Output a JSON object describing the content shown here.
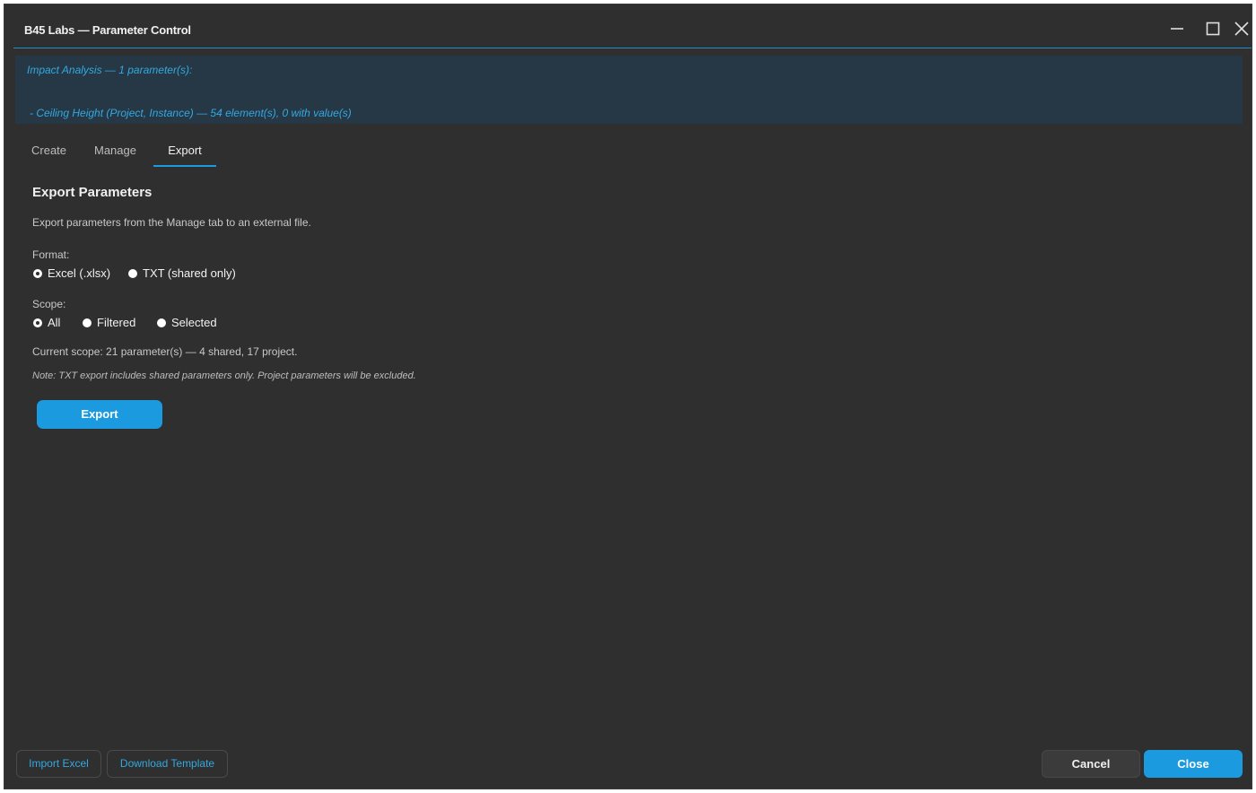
{
  "window": {
    "title": "B45 Labs — Parameter Control",
    "controls": {
      "minimize": "minimize-icon",
      "maximize": "maximize-icon",
      "close": "close-icon"
    }
  },
  "banner": {
    "line1": "Impact Analysis — 1 parameter(s):",
    "line2": "- Ceiling Height (Project, Instance) — 54 element(s), 0 with value(s)"
  },
  "tabs": [
    {
      "label": "Create",
      "active": false
    },
    {
      "label": "Manage",
      "active": false
    },
    {
      "label": "Export",
      "active": true
    }
  ],
  "export": {
    "title": "Export Parameters",
    "description": "Export parameters from the Manage tab to an external file.",
    "format": {
      "label": "Format:",
      "options": [
        {
          "label": "Excel (.xlsx)",
          "selected": true
        },
        {
          "label": "TXT (shared only)",
          "selected": false
        }
      ]
    },
    "scope": {
      "label": "Scope:",
      "options": [
        {
          "label": "All",
          "selected": true
        },
        {
          "label": "Filtered",
          "selected": false
        },
        {
          "label": "Selected",
          "selected": false
        }
      ]
    },
    "current_scope": "Current scope: 21 parameter(s) — 4 shared, 17 project.",
    "note": "Note: TXT export includes shared parameters only. Project parameters will be excluded.",
    "export_button": "Export"
  },
  "footer": {
    "import_excel": "Import Excel",
    "download_template": "Download Template",
    "cancel": "Cancel",
    "close": "Close"
  },
  "colors": {
    "accent": "#1b9ae0",
    "banner_bg": "#263845",
    "banner_text": "#34a8e0",
    "window_bg": "#2f2f2f"
  }
}
